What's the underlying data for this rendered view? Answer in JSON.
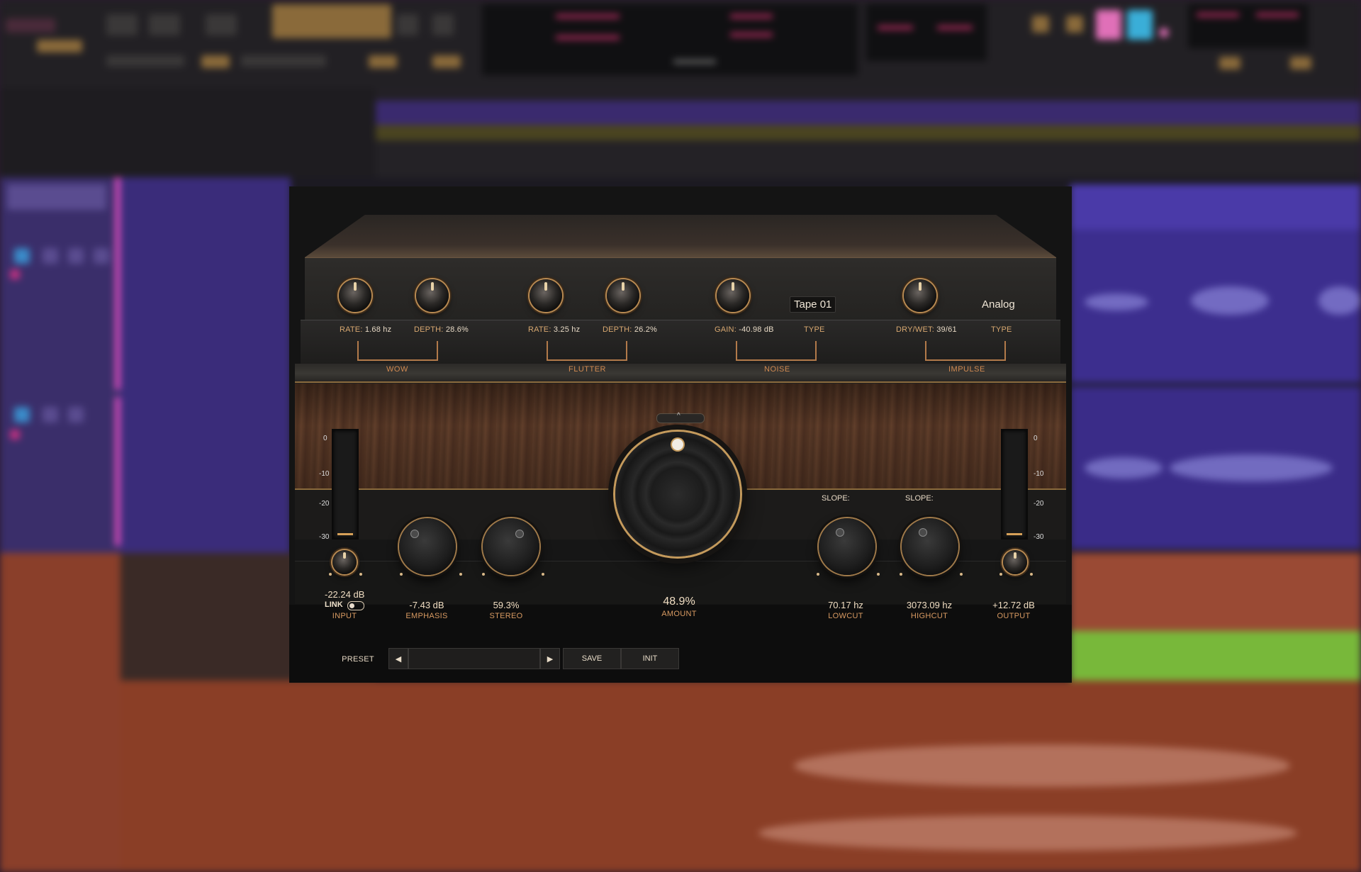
{
  "plugin": {
    "wow": {
      "section": "WOW",
      "rate_label": "RATE:",
      "rate_value": "1.68 hz",
      "depth_label": "DEPTH:",
      "depth_value": "28.6%"
    },
    "flutter": {
      "section": "FLUTTER",
      "rate_label": "RATE:",
      "rate_value": "3.25 hz",
      "depth_label": "DEPTH:",
      "depth_value": "26.2%"
    },
    "noise": {
      "section": "NOISE",
      "gain_label": "GAIN:",
      "gain_value": "-40.98 dB",
      "type_label": "TYPE",
      "type_value": "Tape 01"
    },
    "impulse": {
      "section": "IMPULSE",
      "drywet_label": "DRY/WET:",
      "drywet_value": "39/61",
      "type_label": "TYPE",
      "type_value": "Analog"
    },
    "up_arrow": "^",
    "meter_ticks": [
      "0",
      "-10",
      "-20",
      "-30"
    ],
    "slope_label": "SLOPE:",
    "input": {
      "value": "-22.24 dB",
      "label": "INPUT",
      "link_label": "LINK"
    },
    "emphasis": {
      "value": "-7.43 dB",
      "label": "EMPHASIS"
    },
    "stereo": {
      "value": "59.3%",
      "label": "STEREO"
    },
    "amount": {
      "value": "48.9%",
      "label": "AMOUNT"
    },
    "lowcut": {
      "value": "70.17 hz",
      "label": "LOWCUT"
    },
    "highcut": {
      "value": "3073.09 hz",
      "label": "HIGHCUT"
    },
    "output": {
      "value": "+12.72 dB",
      "label": "OUTPUT"
    },
    "preset": {
      "label": "PRESET",
      "prev": "◀",
      "next": "▶",
      "current": "",
      "save": "SAVE",
      "init": "INIT"
    }
  },
  "colors": {
    "accent_gold": "#c49a5c",
    "label_orange": "#d89a62",
    "wood": "#5a3a28",
    "track_purple": "#3c2e8e",
    "track_orange": "#8a3e26",
    "track_green": "#78b83a"
  }
}
